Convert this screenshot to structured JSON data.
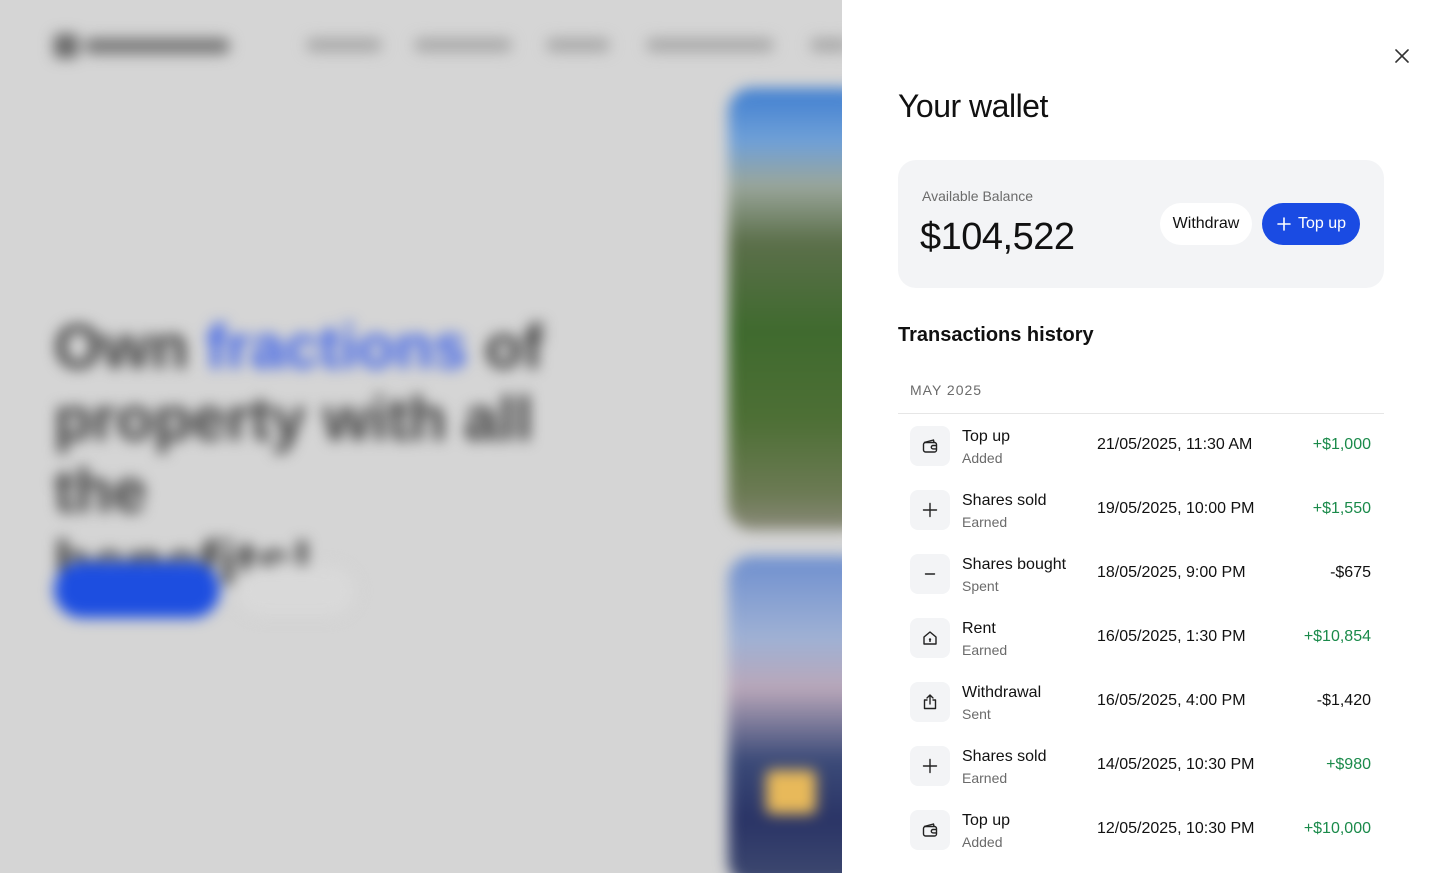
{
  "background": {
    "hero_line1_a": "Own ",
    "hero_line1_accent": "fractions",
    "hero_line1_b": " of",
    "hero_line2": "property with all the",
    "hero_line3": "benefits!"
  },
  "wallet": {
    "title": "Your wallet",
    "balance_label": "Available Balance",
    "balance_value": "$104,522",
    "withdraw_label": "Withdraw",
    "topup_label": "Top up"
  },
  "history": {
    "title": "Transactions history",
    "month": "MAY 2025",
    "transactions": [
      {
        "icon": "wallet-icon",
        "name": "Top up",
        "status": "Added",
        "date": "21/05/2025, 11:30 AM",
        "amount": "+$1,000",
        "positive": true
      },
      {
        "icon": "plus-icon",
        "name": "Shares sold",
        "status": "Earned",
        "date": "19/05/2025, 10:00 PM",
        "amount": "+$1,550",
        "positive": true
      },
      {
        "icon": "minus-icon",
        "name": "Shares bought",
        "status": "Spent",
        "date": "18/05/2025, 9:00 PM",
        "amount": "-$675",
        "positive": false
      },
      {
        "icon": "home-icon",
        "name": "Rent",
        "status": "Earned",
        "date": "16/05/2025, 1:30 PM",
        "amount": "+$10,854",
        "positive": true
      },
      {
        "icon": "upload-icon",
        "name": "Withdrawal",
        "status": "Sent",
        "date": "16/05/2025, 4:00 PM",
        "amount": "-$1,420",
        "positive": false
      },
      {
        "icon": "plus-icon",
        "name": "Shares sold",
        "status": "Earned",
        "date": "14/05/2025, 10:30 PM",
        "amount": "+$980",
        "positive": true
      },
      {
        "icon": "wallet-icon",
        "name": "Top up",
        "status": "Added",
        "date": "12/05/2025, 10:30 PM",
        "amount": "+$10,000",
        "positive": true
      }
    ]
  },
  "colors": {
    "accent": "#1a4be3",
    "positive": "#1a8a4a",
    "card_bg": "#f3f4f6",
    "overlay": "#d6d6d6"
  }
}
